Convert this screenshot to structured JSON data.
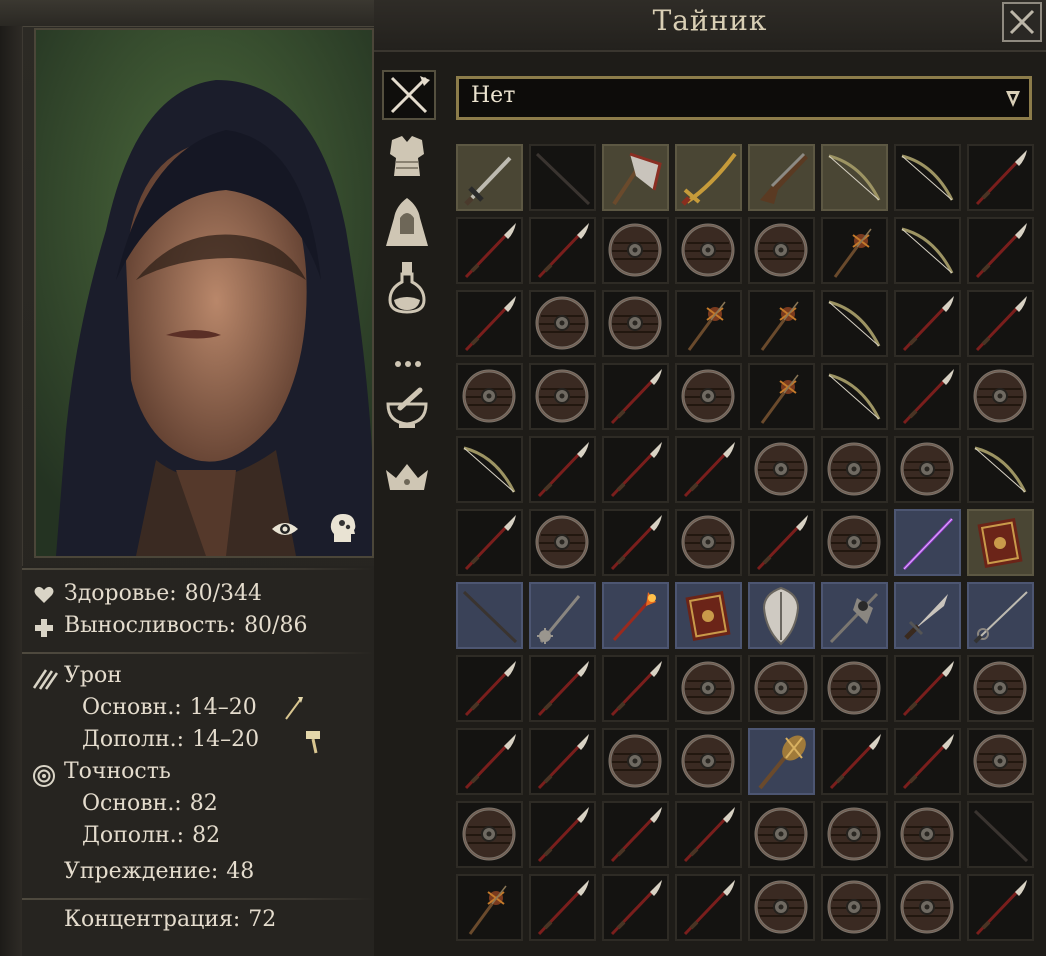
{
  "stash": {
    "title": "Тайник",
    "filter_selected": "Нет",
    "filter_tabs": [
      "weapon-icon",
      "armor-icon",
      "cloak-icon",
      "potion-icon",
      "more-icon",
      "mortar-icon",
      "crown-icon"
    ]
  },
  "stats": {
    "health_label": "Здоровье:",
    "health_value": "80/344",
    "endurance_label": "Выносливость:",
    "endurance_value": "80/86",
    "damage_label": "Урон",
    "main_label": "Основн.:",
    "main_damage": "14–20",
    "off_label": "Дополн.:",
    "off_damage": "14–20",
    "accuracy_label": "Точность",
    "main_accuracy": "82",
    "off_accuracy": "82",
    "deflection_label": "Упреждение:",
    "deflection_value": "48",
    "concentration_label": "Концентрация:",
    "concentration_value": "72"
  },
  "grid": [
    [
      "sword",
      "stick",
      "axe",
      "sabre",
      "pistol",
      "bow",
      "bow",
      "spear"
    ],
    [
      "spear",
      "spear",
      "shield",
      "shield",
      "shield",
      "flail",
      "bow",
      "spear"
    ],
    [
      "spear",
      "shield",
      "shield",
      "flail",
      "flail",
      "bow",
      "spear",
      "spear"
    ],
    [
      "shield",
      "shield",
      "spear",
      "shield",
      "flail",
      "bow",
      "spear",
      "shield"
    ],
    [
      "bow",
      "spear",
      "spear",
      "spear",
      "shield",
      "shield",
      "shield",
      "bow"
    ],
    [
      "spear",
      "shield",
      "spear",
      "shield",
      "spear",
      "shield",
      "staff",
      "book"
    ],
    [
      "stick",
      "morning",
      "wand",
      "book",
      "shield-kite",
      "axe-pole",
      "dagger",
      "rapier"
    ],
    [
      "spear",
      "spear",
      "spear",
      "shield",
      "shield",
      "shield",
      "spear",
      "shield"
    ],
    [
      "spear",
      "spear",
      "shield",
      "shield",
      "mace",
      "spear",
      "spear",
      "shield"
    ],
    [
      "shield",
      "spear",
      "spear",
      "spear",
      "shield",
      "shield",
      "shield",
      "stick"
    ],
    [
      "flail",
      "spear",
      "spear",
      "spear",
      "shield",
      "shield",
      "shield",
      "spear"
    ]
  ],
  "grid_highlight": [
    [
      "eq",
      "",
      "eq",
      "eq",
      "eq",
      "eq",
      "",
      ""
    ],
    [
      "",
      "",
      "",
      "",
      "",
      "",
      "",
      ""
    ],
    [
      "",
      "",
      "",
      "",
      "",
      "",
      "",
      ""
    ],
    [
      "",
      "",
      "",
      "",
      "",
      "",
      "",
      ""
    ],
    [
      "",
      "",
      "",
      "",
      "",
      "",
      "",
      ""
    ],
    [
      "",
      "",
      "",
      "",
      "",
      "",
      "bl",
      "eq"
    ],
    [
      "bl",
      "bl",
      "bl",
      "bl",
      "bl",
      "bl",
      "bl",
      "bl"
    ],
    [
      "",
      "",
      "",
      "",
      "",
      "",
      "",
      ""
    ],
    [
      "",
      "",
      "",
      "",
      "bl",
      "",
      "",
      ""
    ],
    [
      "",
      "",
      "",
      "",
      "",
      "",
      "",
      ""
    ],
    [
      "",
      "",
      "",
      "",
      "",
      "",
      "",
      ""
    ]
  ]
}
